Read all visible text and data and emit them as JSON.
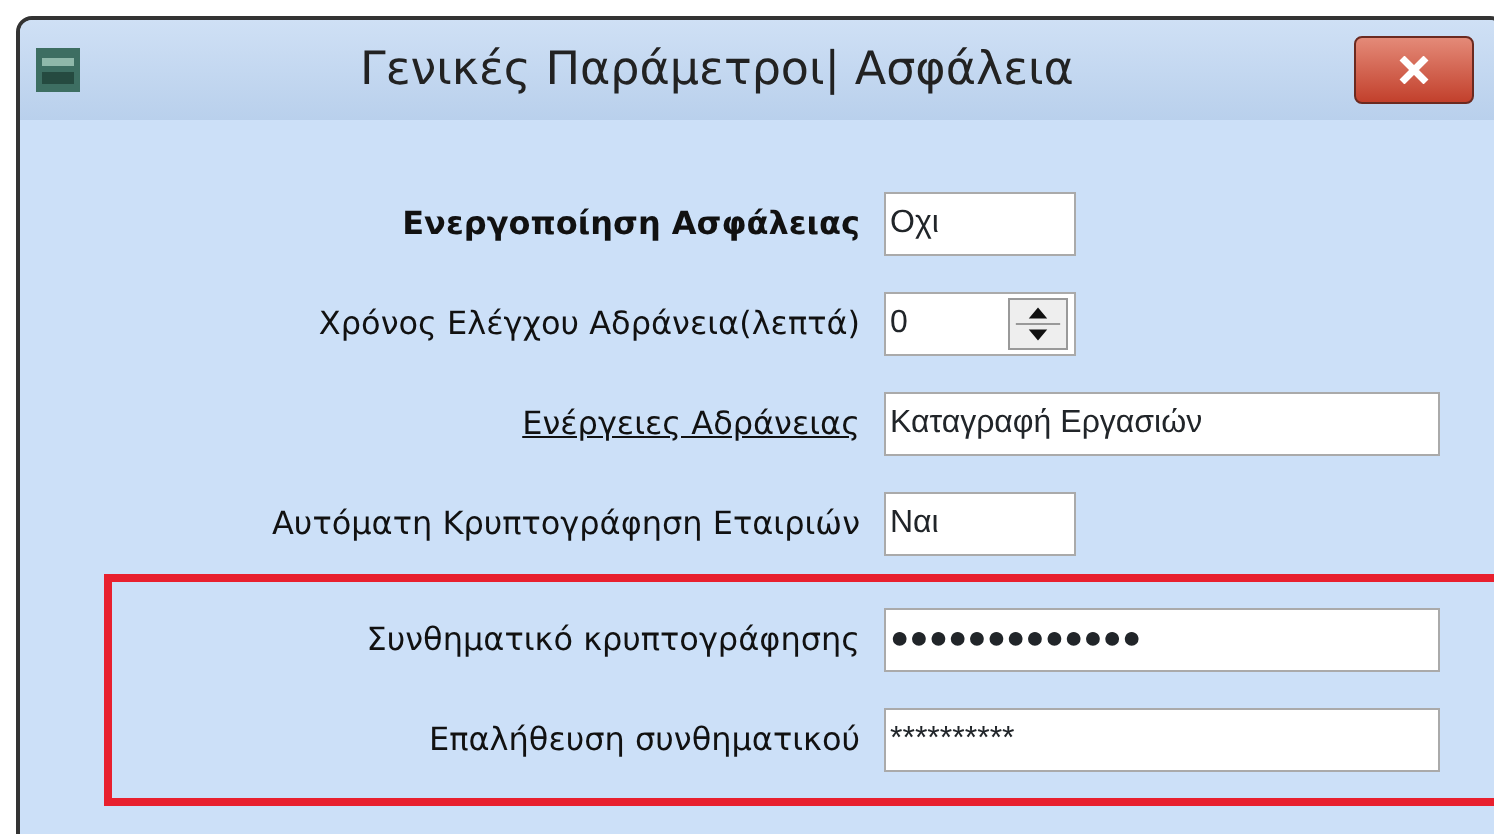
{
  "window": {
    "title": "Γενικές Παράμετροι| Ασφάλεια"
  },
  "rows": [
    {
      "label": "Ενεργοποίηση Ασφάλειας",
      "bold": true,
      "underlined": false,
      "kind": "short",
      "value": "Οχι"
    },
    {
      "label": "Χρόνος Ελέγχου Αδράνεια(λεπτά)",
      "bold": false,
      "underlined": false,
      "kind": "spin",
      "value": "0"
    },
    {
      "label": "Ενέργειες Αδράνειας",
      "bold": false,
      "underlined": true,
      "kind": "wide",
      "value": "Καταγραφή Εργασιών"
    },
    {
      "label": "Αυτόματη Κρυπτογράφηση Εταιριών",
      "bold": false,
      "underlined": false,
      "kind": "short",
      "value": "Ναι"
    }
  ],
  "highlighted_group": {
    "rows": [
      {
        "label": "Συνθηματικό κρυπτογράφησης",
        "bold": false,
        "underlined": false,
        "kind": "wide",
        "value": "●●●●●●●●●●●●●"
      },
      {
        "label": "Επαλήθευση συνθηματικού",
        "bold": false,
        "underlined": false,
        "kind": "wide",
        "value": "**********"
      }
    ]
  }
}
